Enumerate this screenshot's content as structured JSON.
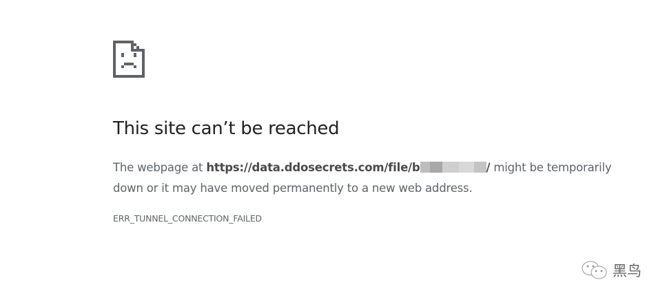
{
  "error_page": {
    "icon": "sad-page-icon",
    "title": "This site can’t be reached",
    "desc_prefix": "The webpage at ",
    "url_visible": "https://data.ddosecrets.com/file/b",
    "url_suffix": "/",
    "desc_suffix": " might be temporarily down or it may have moved permanently to a new web address.",
    "error_code": "ERR_TUNNEL_CONNECTION_FAILED"
  },
  "watermark": {
    "icon": "wechat-icon",
    "text": "黑鸟"
  }
}
